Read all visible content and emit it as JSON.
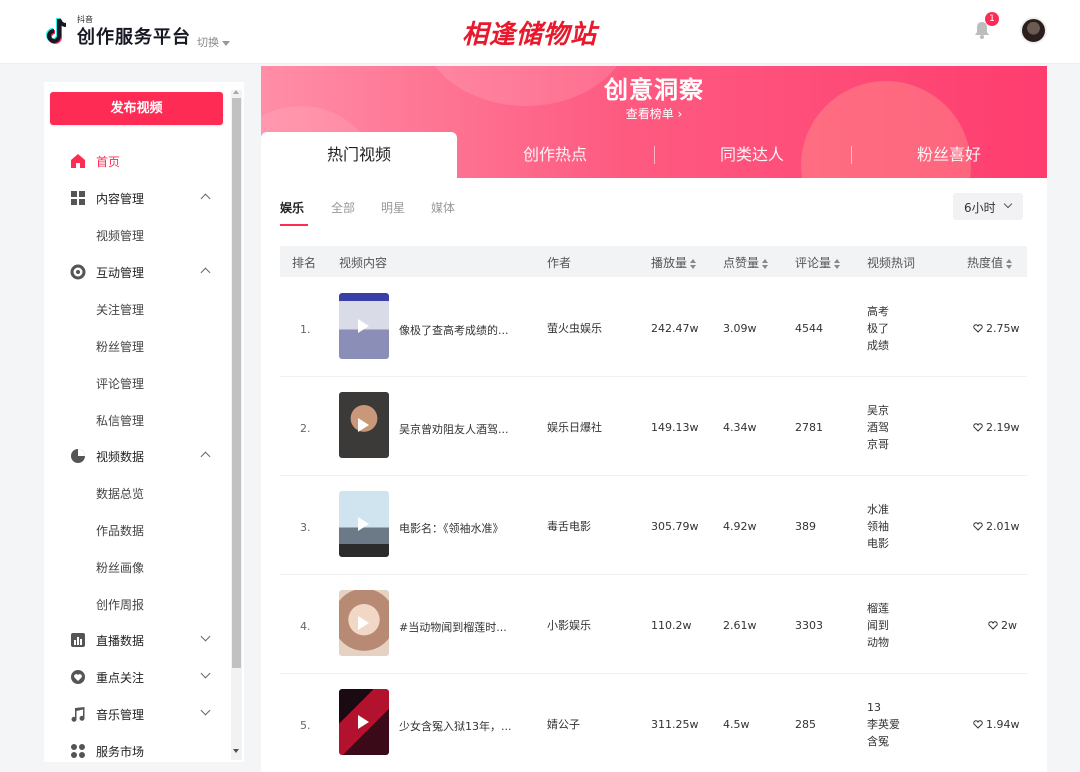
{
  "header": {
    "brand_small": "抖音",
    "brand_main": "创作服务平台",
    "switch_label": "切换",
    "watermark": "相逢储物站",
    "notification_count": "1"
  },
  "sidebar": {
    "publish_label": "发布视频",
    "items": [
      {
        "label": "首页",
        "icon": "home-icon"
      },
      {
        "label": "内容管理",
        "icon": "grid-icon",
        "children": [
          "视频管理"
        ]
      },
      {
        "label": "互动管理",
        "icon": "interaction-icon",
        "children": [
          "关注管理",
          "粉丝管理",
          "评论管理",
          "私信管理"
        ]
      },
      {
        "label": "视频数据",
        "icon": "pie-chart-icon",
        "children": [
          "数据总览",
          "作品数据",
          "粉丝画像",
          "创作周报"
        ]
      },
      {
        "label": "直播数据",
        "icon": "bar-chart-icon"
      },
      {
        "label": "重点关注",
        "icon": "heart-icon"
      },
      {
        "label": "音乐管理",
        "icon": "music-icon"
      },
      {
        "label": "服务市场",
        "icon": "apps-icon"
      }
    ]
  },
  "banner": {
    "title": "创意洞察",
    "link": "查看榜单 ›"
  },
  "tabs": [
    "热门视频",
    "创作热点",
    "同类达人",
    "粉丝喜好"
  ],
  "subtabs": [
    "娱乐",
    "全部",
    "明星",
    "媒体"
  ],
  "period": "6小时",
  "table": {
    "headers": [
      "排名",
      "视频内容",
      "作者",
      "播放量",
      "点赞量",
      "评论量",
      "视频热词",
      "热度值"
    ],
    "rows": [
      {
        "rank": "1.",
        "title": "像极了查高考成绩的...",
        "author": "萤火虫娱乐",
        "plays": "242.47w",
        "likes": "3.09w",
        "comments": "4544",
        "keywords": [
          "高考",
          "极了",
          "成绩"
        ],
        "heat": "2.75w"
      },
      {
        "rank": "2.",
        "title": "吴京曾劝阻友人酒驾...",
        "author": "娱乐日爆社",
        "plays": "149.13w",
        "likes": "4.34w",
        "comments": "2781",
        "keywords": [
          "吴京",
          "酒驾",
          "京哥"
        ],
        "heat": "2.19w"
      },
      {
        "rank": "3.",
        "title": "电影名：《领袖水准》",
        "author": "毒舌电影",
        "plays": "305.79w",
        "likes": "4.92w",
        "comments": "389",
        "keywords": [
          "水准",
          "领袖",
          "电影"
        ],
        "heat": "2.01w"
      },
      {
        "rank": "4.",
        "title": "#当动物闻到榴莲时...",
        "author": "小影娱乐",
        "plays": "110.2w",
        "likes": "2.61w",
        "comments": "3303",
        "keywords": [
          "榴莲",
          "闻到",
          "动物"
        ],
        "heat": "2w"
      },
      {
        "rank": "5.",
        "title": "少女含冤入狱13年，...",
        "author": "婧公子",
        "plays": "311.25w",
        "likes": "4.5w",
        "comments": "285",
        "keywords": [
          "13",
          "李英爱",
          "含冤"
        ],
        "heat": "1.94w"
      }
    ]
  },
  "colors": {
    "accent": "#fe2c55",
    "banner": "#fe5b81"
  }
}
